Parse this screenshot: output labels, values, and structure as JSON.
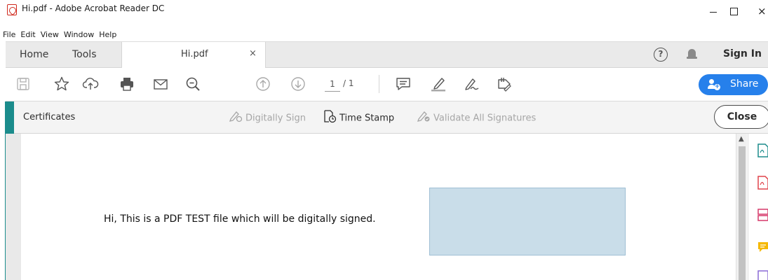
{
  "window": {
    "title": "Hi.pdf - Adobe Acrobat Reader DC",
    "minimize": "minimize-icon",
    "maximize": "maximize-icon",
    "close_glyph": "×"
  },
  "menu": {
    "items": [
      "File",
      "Edit",
      "View",
      "Window",
      "Help"
    ]
  },
  "tabs": {
    "home": "Home",
    "tools": "Tools",
    "document": "Hi.pdf",
    "close_glyph": "×"
  },
  "header": {
    "help_glyph": "?",
    "sign_in": "Sign In"
  },
  "toolbar": {
    "page_current": "1",
    "page_total": "/ 1",
    "share_label": "Share",
    "icons": [
      "save-icon",
      "bookmark-star-icon",
      "cloud-upload-icon",
      "print-icon",
      "email-icon",
      "zoom-search-icon",
      "previous-page-icon",
      "next-page-icon",
      "comment-icon",
      "highlight-pen-icon",
      "fill-sign-icon",
      "edit-sign-icon"
    ]
  },
  "certificates": {
    "title": "Certificates",
    "digitally_sign": "Digitally Sign",
    "time_stamp": "Time Stamp",
    "validate_all": "Validate All Signatures",
    "close": "Close"
  },
  "document": {
    "body_text": "Hi, This is a PDF TEST file which will be digitally signed."
  },
  "colors": {
    "accent_teal": "#1b8c8c",
    "share_blue": "#2680eb",
    "signature_field": "#c9dde9",
    "disabled_text": "#a6a6a6"
  },
  "right_panel": {
    "icons": [
      "export-pdf-icon",
      "create-pdf-icon",
      "organize-pages-icon",
      "comment-panel-icon",
      "more-tools-icon"
    ]
  }
}
